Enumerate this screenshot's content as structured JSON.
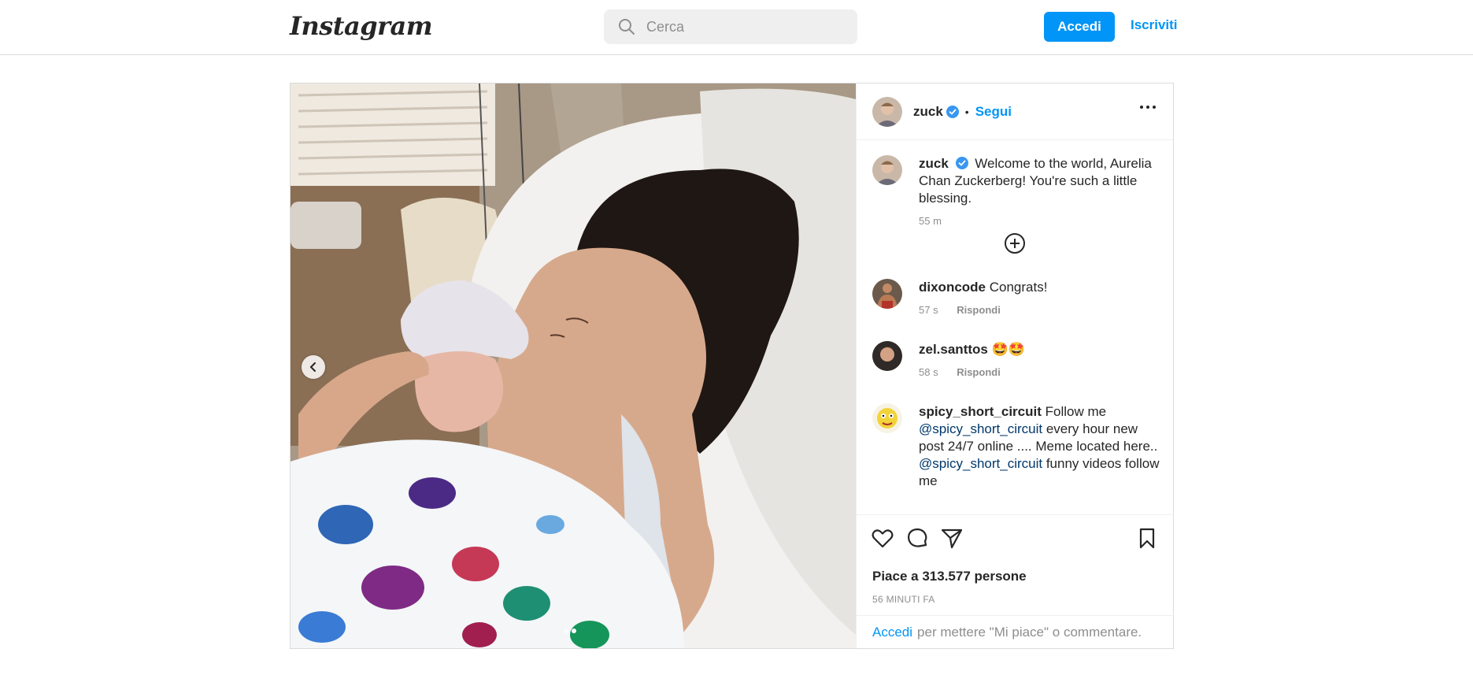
{
  "nav": {
    "logo": "Instagram",
    "search_placeholder": "Cerca",
    "login_label": "Accedi",
    "signup_label": "Iscriviti"
  },
  "post": {
    "author": "zuck",
    "follow_label": "Segui",
    "separator": "•",
    "caption": {
      "username": "zuck",
      "text": "Welcome to the world, Aurelia Chan Zuckerberg! You're such a little blessing.",
      "time": "55 m"
    },
    "comments": [
      {
        "username": "dixoncode",
        "text": "Congrats!",
        "time": "57 s",
        "reply": "Rispondi"
      },
      {
        "username": "zel.santtos",
        "text": "🤩🤩",
        "time": "58 s",
        "reply": "Rispondi"
      },
      {
        "username": "spicy_short_circuit",
        "text_1": "Follow me",
        "mention_1": "@spicy_short_circuit",
        "text_2": "every hour new post 24/7 online .... Meme located here..",
        "mention_2": "@spicy_short_circuit",
        "text_3": "funny videos follow me"
      }
    ],
    "likes": "Piace a 313.577 persone",
    "posted": "56 MINUTI FA",
    "login_prompt": {
      "link": "Accedi",
      "text": "per mettere \"Mi piace\" o commentare."
    },
    "carousel": {
      "current": 2,
      "total": 2
    }
  },
  "icons": {
    "search": "search-icon",
    "verified": "verified-badge-icon",
    "more": "more-options-icon",
    "add": "add-circle-icon",
    "like": "heart-icon",
    "comment": "comment-icon",
    "share": "share-icon",
    "save": "bookmark-icon",
    "prev": "chevron-left-icon"
  },
  "colors": {
    "accent": "#0095f6",
    "text": "#262626",
    "muted": "#8e8e8e",
    "verified": "#3897f0"
  }
}
